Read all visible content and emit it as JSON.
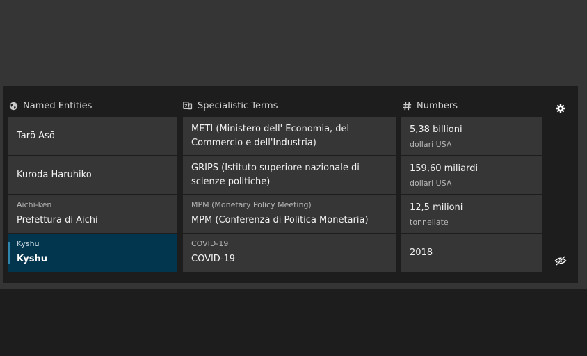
{
  "columns": {
    "named_entities": {
      "title": "Named Entities",
      "icon": "globe-icon",
      "items": [
        {
          "label": "",
          "value": "Tarō Asō"
        },
        {
          "label": "",
          "value": "Kuroda Haruhiko"
        },
        {
          "label": "Aichi-ken",
          "value": "Prefettura di Aichi"
        },
        {
          "label": "Kyshu",
          "value": "Kyshu",
          "selected": true
        }
      ]
    },
    "specialistic_terms": {
      "title": "Specialistic Terms",
      "icon": "translate-icon",
      "items": [
        {
          "label": "",
          "value": "METI (Ministero dell' Economia, del Commercio e dell'Industria)"
        },
        {
          "label": "",
          "value": "GRIPS (Istituto superiore nazionale di scienze politiche)"
        },
        {
          "label": "MPM (Monetary Policy Meeting)",
          "value": "MPM (Conferenza di Politica Monetaria)"
        },
        {
          "label": "COVID-19",
          "value": "COVID-19"
        }
      ]
    },
    "numbers": {
      "title": "Numbers",
      "icon": "hash-icon",
      "items": [
        {
          "value": "5,38 billioni",
          "unit": "dollari USA"
        },
        {
          "value": "159,60 miliardi",
          "unit": "dollari USA"
        },
        {
          "value": "12,5 milioni",
          "unit": "tonnellate"
        },
        {
          "value": "2018",
          "unit": ""
        }
      ]
    }
  },
  "controls": {
    "settings_icon": "gear-icon",
    "visibility_icon": "eye-slash-icon"
  },
  "colors": {
    "panel_bg": "#1d1d1d",
    "outer_bg": "#353535",
    "cell_bg": "#363636",
    "selected_bg": "#02364f",
    "selected_accent": "#2e85ad"
  }
}
